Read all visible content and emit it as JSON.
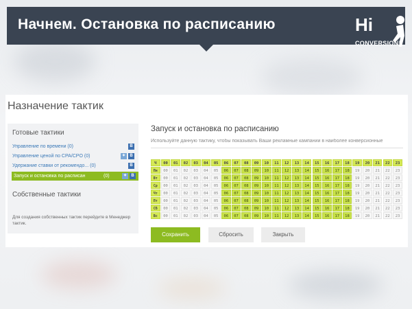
{
  "banner": {
    "title": "Начнем. Остановка по расписанию"
  },
  "logo": {
    "hi": "Hi",
    "conversion": "CONVERSION!"
  },
  "card": {
    "title": "Назначение тактик"
  },
  "sidebar": {
    "ready_heading": "Готовые тактики",
    "items": [
      {
        "label": "Управление по времени (0)",
        "count": "",
        "badges": [
          "B"
        ]
      },
      {
        "label": "Управление ценой по CPA/CPO (0)",
        "count": "",
        "badges": [
          "g",
          "B"
        ]
      },
      {
        "label": "Удержание ставки от рекомендо... (0)",
        "count": "",
        "badges": [
          "B"
        ]
      },
      {
        "label": "Запуск и остановка по расписан",
        "count": "(0)",
        "badges": [
          "g",
          "B"
        ],
        "active": true
      }
    ],
    "own_heading": "Собственные тактики",
    "note": "Для создания собственных тактик перейдите в Менеджер тактик."
  },
  "panel": {
    "title": "Запуск и остановка по расписанию",
    "description": "Используйте данную тактику, чтобы показывать Ваши рекламные кампании в наиболее конверсионные"
  },
  "schedule": {
    "corner": "Ч",
    "hours": [
      "00",
      "01",
      "02",
      "03",
      "04",
      "05",
      "06",
      "07",
      "08",
      "09",
      "10",
      "11",
      "12",
      "13",
      "14",
      "15",
      "16",
      "17",
      "18",
      "19",
      "20",
      "21",
      "22",
      "23"
    ],
    "days": [
      "Пн",
      "Вт",
      "Ср",
      "Чт",
      "Пт",
      "Сб",
      "Вс"
    ],
    "active_hours": [
      6,
      7,
      8,
      9,
      10,
      11,
      12,
      13,
      14,
      15,
      16,
      17,
      18
    ]
  },
  "buttons": {
    "save": "Сохранить",
    "reset": "Сбросить",
    "close": "Закрыть"
  }
}
